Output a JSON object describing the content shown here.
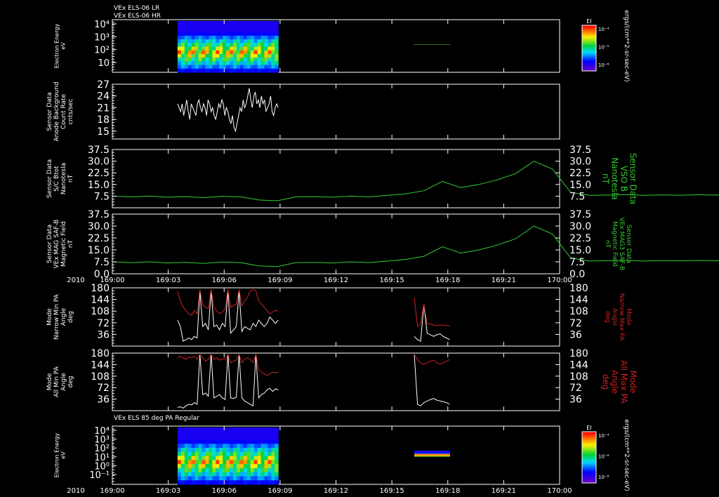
{
  "chart_data": [
    {
      "type": "heatmap",
      "titles": [
        "VEx ELS-06 LR",
        "VEx ELS-06 HR"
      ],
      "ylabel": [
        "Electron Energy",
        "eV"
      ],
      "yticks": [
        "10⁴",
        "10³",
        "10²",
        "10"
      ],
      "ylim": [
        1,
        20000
      ],
      "yscale": "log",
      "colorbar": {
        "label": "EI",
        "ticks": [
          "10⁻⁴",
          "10⁻⁶",
          "10⁻⁸"
        ],
        "units": "ergs/(cm**2-sr-sec-eV)"
      },
      "segments": [
        {
          "x_start": 3.5,
          "x_end": 8.9
        },
        {
          "x_start": 16.2,
          "x_end": 18.1
        }
      ]
    },
    {
      "type": "line",
      "ylabel": [
        "Sensor Data",
        "Anode Background",
        "Count Rate",
        "cnts/sec"
      ],
      "yticks": [
        15,
        18,
        21,
        24,
        27
      ],
      "ylim": [
        13,
        27
      ],
      "series": [
        {
          "color": "#ffffff",
          "x_start": 3.5,
          "x_end": 8.9,
          "values": [
            22,
            21,
            20,
            22,
            19,
            21,
            23,
            20,
            18,
            22,
            21,
            20,
            19,
            22,
            23,
            21,
            20,
            22,
            21,
            19,
            23,
            22,
            20,
            21,
            19,
            18,
            20,
            22,
            21,
            23,
            22,
            19,
            21,
            20,
            18,
            17,
            19,
            16,
            15,
            17,
            19,
            21,
            20,
            23,
            21,
            22,
            24,
            26,
            23,
            21,
            24,
            25,
            22,
            23,
            21,
            24,
            22,
            23,
            20,
            21,
            22,
            24,
            20,
            19,
            21,
            22,
            21
          ]
        }
      ]
    },
    {
      "type": "line",
      "ylabel": [
        "Sensor Data",
        "S/C Btot",
        "Nanotesla",
        "nT"
      ],
      "ylabel_right": [
        "Sensor Data",
        "VSO B",
        "Nanotesla",
        "nT"
      ],
      "yticks": [
        7.5,
        15.0,
        22.5,
        30.0,
        37.5
      ],
      "ylim": [
        0,
        37.5
      ],
      "series": [
        {
          "color": "#33cc33",
          "x_start": 0,
          "x_end": 60,
          "values": [
            7.5,
            7,
            7.5,
            6.8,
            7.2,
            6.5,
            7.4,
            7,
            5,
            4.5,
            7,
            7.2,
            6.8,
            7.5,
            7,
            8,
            9,
            11,
            17,
            13,
            15,
            18,
            22,
            30,
            25,
            10,
            8,
            8.2,
            8.5,
            8,
            8.3,
            8.1,
            8.4,
            8.2,
            8,
            8.3,
            8.5,
            8.2,
            8.4,
            8.3,
            8.1,
            8.3,
            8.5,
            8.4,
            8.6,
            8.2,
            8.4,
            8.3,
            8,
            7.5,
            7.8,
            7.9,
            8,
            6.5,
            7,
            7.5,
            6.4,
            7,
            5.5,
            5,
            7,
            7.5
          ]
        }
      ]
    },
    {
      "type": "line",
      "ylabel": [
        "Sensor Data",
        "VEx MAG SAF-B",
        "Magnetic Field",
        "nT"
      ],
      "ylabel_right": [
        "Sensor Data",
        "VEx MAG3 SAF-B",
        "Magnetic Field",
        "nT"
      ],
      "yticks": [
        0.0,
        7.5,
        15.0,
        22.5,
        30.0,
        37.5
      ],
      "ylim": [
        0,
        37.5
      ],
      "series": [
        {
          "color": "#33cc33",
          "x_start": 0,
          "x_end": 60,
          "values": [
            7.5,
            7,
            7.5,
            6.8,
            7.2,
            6.5,
            7.4,
            7,
            5,
            4.5,
            7,
            7.2,
            6.8,
            7.5,
            7,
            8,
            9,
            11,
            17,
            13,
            15,
            18,
            22,
            30,
            25,
            10,
            8,
            8.2,
            8.5,
            8,
            8.3,
            8.1,
            8.4,
            8.2,
            8,
            8.3,
            8.5,
            8.2,
            8.4,
            8.3,
            8.1,
            8.3,
            8.5,
            8.4,
            8.6,
            8.2,
            8.4,
            8.3,
            8,
            7.5,
            7.8,
            7.9,
            8,
            6.5,
            7,
            7.5,
            6.4,
            7,
            5.5,
            5,
            7,
            7.5
          ]
        }
      ]
    },
    {
      "type": "line",
      "ylabel": [
        "Mode",
        "Narrow Min PA",
        "Angle",
        "deg"
      ],
      "ylabel_right": [
        "Mode",
        "Narrow Max PA",
        "Angle",
        "deg"
      ],
      "yticks": [
        36,
        72,
        108,
        144,
        180
      ],
      "ylim": [
        0,
        180
      ],
      "series": [
        {
          "color": "#ffffff",
          "x_start": 3.5,
          "x_end": 8.9,
          "values": [
            80,
            60,
            15,
            20,
            25,
            20,
            30,
            25,
            170,
            60,
            70,
            50,
            170,
            60,
            65,
            50,
            70,
            60,
            170,
            40,
            50,
            60,
            170,
            45,
            60,
            55,
            50,
            70,
            60,
            80,
            70,
            60,
            70,
            90,
            80,
            70,
            80
          ]
        },
        {
          "color": "#cc2222",
          "x_start": 3.5,
          "x_end": 8.9,
          "values": [
            170,
            140,
            120,
            110,
            100,
            95,
            110,
            100,
            175,
            130,
            120,
            115,
            175,
            120,
            110,
            100,
            105,
            115,
            175,
            120,
            125,
            130,
            175,
            125,
            140,
            150,
            170,
            175,
            170,
            140,
            130,
            120,
            110,
            100,
            105,
            110,
            108
          ]
        },
        {
          "color": "#ffffff",
          "x_start": 16.2,
          "x_end": 18.1,
          "values": [
            30,
            20,
            15,
            130,
            40,
            35,
            30,
            35,
            38,
            30,
            25,
            20
          ]
        },
        {
          "color": "#cc2222",
          "x_start": 16.2,
          "x_end": 18.1,
          "values": [
            150,
            60,
            70,
            130,
            70,
            68,
            65,
            63,
            65,
            64,
            63,
            62
          ]
        }
      ]
    },
    {
      "type": "line",
      "ylabel": [
        "Mode",
        "All Min PA",
        "Angle",
        "deg"
      ],
      "ylabel_right": [
        "Mode",
        "All Max PA",
        "Angle",
        "deg"
      ],
      "yticks": [
        36,
        72,
        108,
        144,
        180
      ],
      "ylim": [
        0,
        180
      ],
      "series": [
        {
          "color": "#ffffff",
          "x_start": 3.5,
          "x_end": 8.9,
          "values": [
            10,
            12,
            8,
            15,
            20,
            18,
            25,
            20,
            176,
            50,
            55,
            45,
            176,
            40,
            45,
            50,
            40,
            35,
            176,
            40,
            38,
            42,
            176,
            40,
            30,
            25,
            20,
            15,
            176,
            40,
            50,
            55,
            65,
            70,
            60,
            68,
            65
          ]
        },
        {
          "color": "#cc2222",
          "x_start": 3.5,
          "x_end": 8.9,
          "values": [
            165,
            170,
            165,
            160,
            168,
            165,
            170,
            160,
            176,
            165,
            155,
            160,
            176,
            160,
            165,
            158,
            162,
            160,
            176,
            150,
            155,
            158,
            176,
            150,
            160,
            165,
            160,
            150,
            176,
            130,
            120,
            115,
            110,
            115,
            120,
            118,
            120
          ]
        },
        {
          "color": "#ffffff",
          "x_start": 16.2,
          "x_end": 18.1,
          "values": [
            176,
            20,
            15,
            25,
            30,
            35,
            38,
            33,
            30,
            28,
            25,
            20
          ]
        },
        {
          "color": "#cc2222",
          "x_start": 16.2,
          "x_end": 18.1,
          "values": [
            176,
            160,
            150,
            145,
            150,
            155,
            158,
            150,
            145,
            150,
            155,
            160
          ]
        }
      ]
    },
    {
      "type": "heatmap",
      "titles": [
        "VEx ELS 85 deg PA Regular"
      ],
      "ylabel": [
        "Electron Energy",
        "eV"
      ],
      "yticks": [
        "10⁴",
        "10³",
        "10²",
        "10¹",
        "10⁰",
        "10⁻¹"
      ],
      "ylim": [
        0.1,
        20000
      ],
      "yscale": "log",
      "colorbar": {
        "label": "EI",
        "ticks": [
          "10⁻⁴",
          "10⁻⁶",
          "10⁻⁸"
        ],
        "units": "ergs/(cm**2-sr-sec-eV)"
      },
      "segments": [
        {
          "x_start": 3.5,
          "x_end": 8.9
        },
        {
          "x_start": 16.2,
          "x_end": 18.1
        }
      ]
    }
  ],
  "x_axis": {
    "tick_labels": [
      "169:00",
      "169:03",
      "169:06",
      "169:09",
      "169:12",
      "169:15",
      "169:18",
      "169:21",
      "170:00"
    ],
    "year_label": "2010",
    "xlim": [
      0,
      24
    ]
  }
}
